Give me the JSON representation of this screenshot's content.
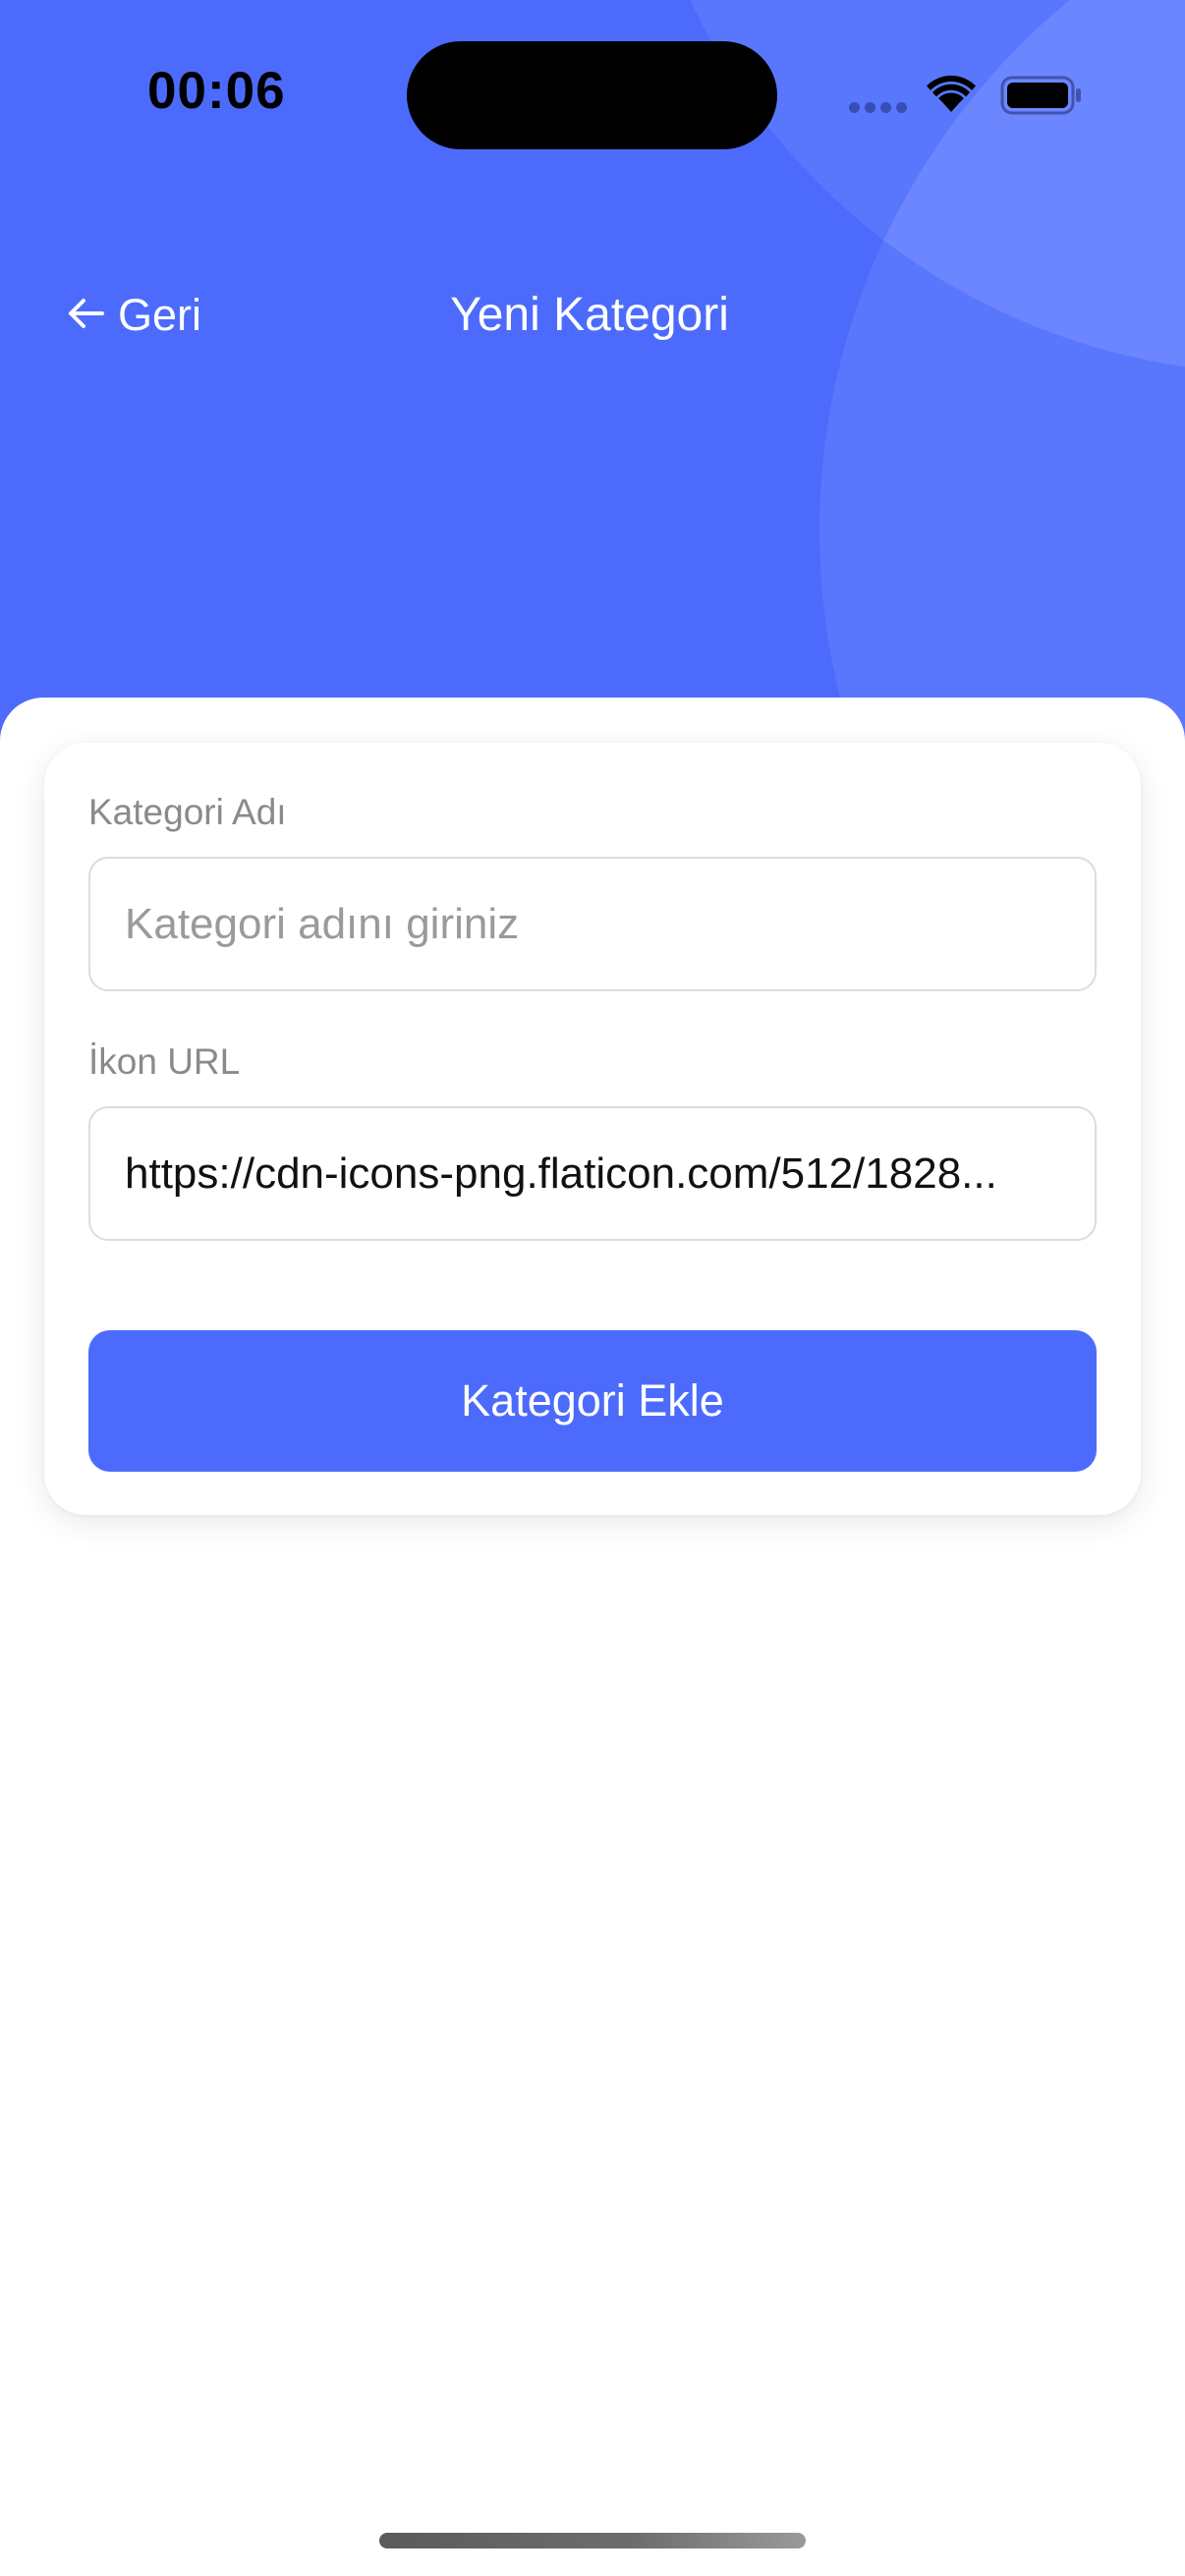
{
  "status_bar": {
    "time": "00:06"
  },
  "nav": {
    "back_label": "Geri",
    "title": "Yeni Kategori"
  },
  "form": {
    "name_label": "Kategori Adı",
    "name_placeholder": "Kategori adını giriniz",
    "name_value": "",
    "icon_label": "İkon URL",
    "icon_value": "https://cdn-icons-png.flaticon.com/512/1828...",
    "submit_label": "Kategori Ekle"
  },
  "colors": {
    "accent": "#4C6BFD",
    "header_bubble": "#5877FD",
    "label_gray": "#8A8A8E",
    "input_border": "#DCDCE0"
  },
  "icons": {
    "back": "arrow-left-icon",
    "signal": "cellular-signal-icon",
    "wifi": "wifi-icon",
    "battery": "battery-icon"
  }
}
